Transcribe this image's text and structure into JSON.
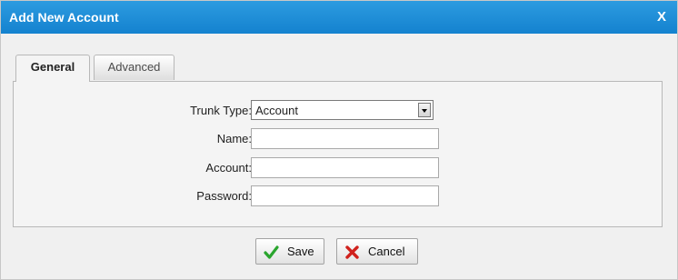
{
  "dialog": {
    "title": "Add New Account",
    "close_label": "X"
  },
  "tabs": [
    {
      "label": "General",
      "active": true
    },
    {
      "label": "Advanced",
      "active": false
    }
  ],
  "form": {
    "trunk_type": {
      "label": "Trunk Type:",
      "value": "Account"
    },
    "name": {
      "label": "Name:",
      "value": ""
    },
    "account": {
      "label": "Account:",
      "value": ""
    },
    "password": {
      "label": "Password:",
      "value": ""
    }
  },
  "buttons": {
    "save_label": "Save",
    "cancel_label": "Cancel"
  },
  "icons": {
    "save": "check-icon",
    "cancel": "x-icon",
    "select": "chevron-down-icon"
  },
  "colors": {
    "titlebar": "#1c8fd9",
    "save_icon": "#2aa52e",
    "cancel_icon": "#d0211d"
  }
}
